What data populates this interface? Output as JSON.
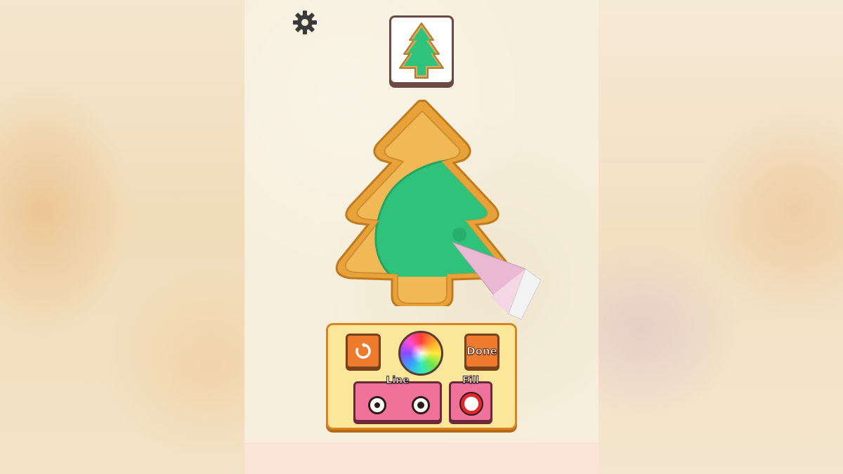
{
  "toolbar": {
    "settings_icon": "gear-icon",
    "target_icon": "tree-cookie-icon"
  },
  "controls": {
    "undo_icon": "undo-icon",
    "color_picker_icon": "color-wheel-icon",
    "done_label": "Done",
    "line_label": "Line",
    "fill_label": "Fill"
  },
  "colors": {
    "icing": "#2fc27a",
    "cookie": "#e8a23a",
    "button_orange": "#ee7a2d",
    "button_pink": "#f0729a",
    "panel": "#fbe79a",
    "fill_selected": "#e3262f"
  }
}
